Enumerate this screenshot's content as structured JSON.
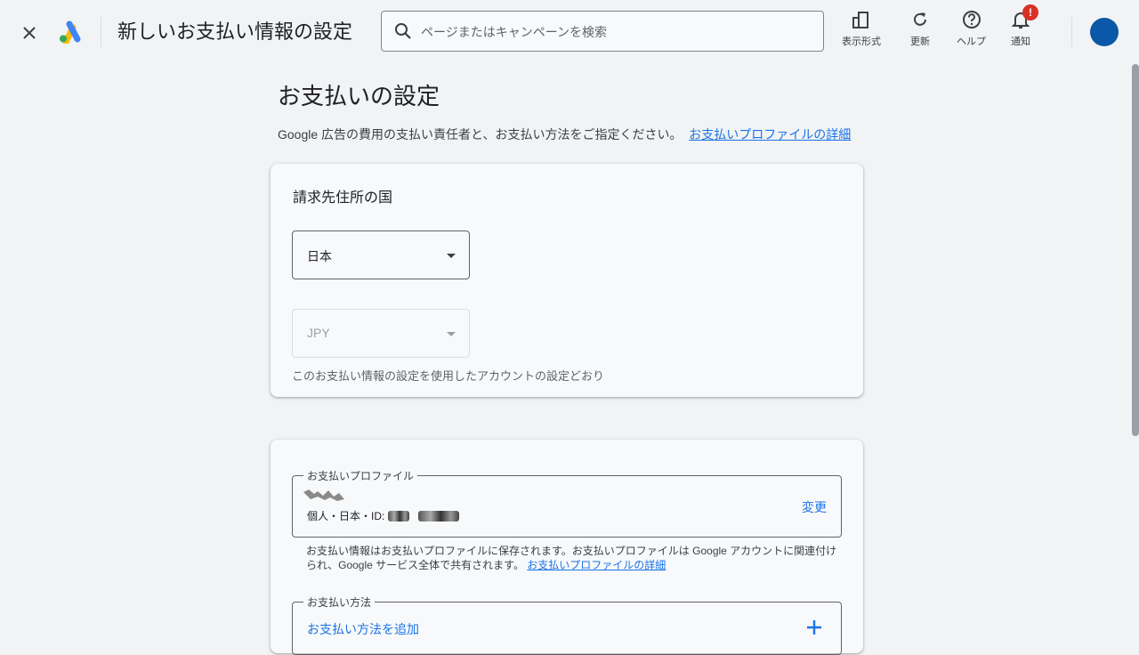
{
  "header": {
    "title": "新しいお支払い情報の設定",
    "search_placeholder": "ページまたはキャンペーンを検索",
    "tools": [
      {
        "label": "表示形式",
        "icon": "appearance-icon"
      },
      {
        "label": "更新",
        "icon": "refresh-icon"
      },
      {
        "label": "ヘルプ",
        "icon": "help-icon"
      },
      {
        "label": "通知",
        "icon": "bell-icon"
      }
    ],
    "notification_badge": "!"
  },
  "main": {
    "heading": "お支払いの設定",
    "intro_text": "Google 広告の費用の支払い責任者と、お支払い方法をご指定ください。",
    "intro_link": "お支払いプロファイルの詳細"
  },
  "billing_country_card": {
    "title": "請求先住所の国",
    "country_value": "日本",
    "currency_value": "JPY",
    "hint": "このお支払い情報の設定を使用したアカウントの設定どおり"
  },
  "payment_card": {
    "profile_legend": "お支払いプロファイル",
    "profile_meta": "個人・日本・ID:",
    "change_label": "変更",
    "note_text": "お支払い情報はお支払いプロファイルに保存されます。お支払いプロファイルは Google アカウントに関連付けられ、Google サービス全体で共有されます。",
    "note_link": "お支払いプロファイルの詳細",
    "method_legend": "お支払い方法",
    "add_method_label": "お支払い方法を追加"
  },
  "colors": {
    "accent": "#1a73e8",
    "background": "#f1f3f4",
    "badge": "#d93025",
    "avatar": "#0b57a8"
  }
}
